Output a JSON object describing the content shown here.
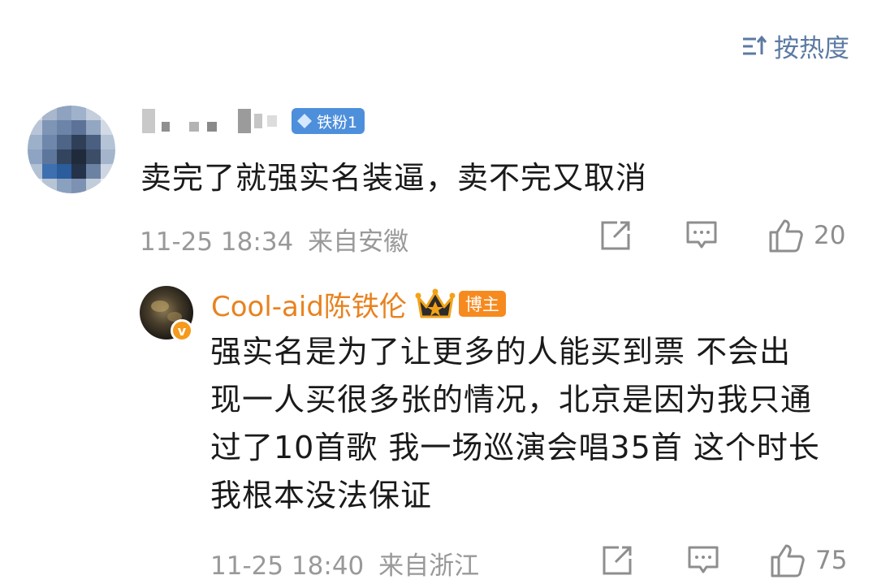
{
  "sort": {
    "label": "按热度",
    "icon": "sort-icon"
  },
  "comment": {
    "author_badge": "铁粉1",
    "text": "卖完了就强实名装逼，卖不完又取消",
    "time": "11-25 18:34",
    "location": "来自安徽",
    "likes": "20",
    "actions": [
      "share-icon",
      "comment-icon",
      "like-icon"
    ]
  },
  "reply": {
    "author": "Cool-aid陈铁伦",
    "role_badge": "博主",
    "verified": "v",
    "lines": [
      "强实名是为了让更多的人能买到票 不会出",
      "现一人买很多张的情况，北京是因为我只通",
      "过了10首歌 我一场巡演会唱35首 这个时长",
      "我根本没法保证"
    ],
    "time": "11-25 18:40",
    "location": "来自浙江",
    "likes": "75"
  },
  "colors": {
    "sort": "#5b7aa3",
    "meta": "#999999",
    "blogger_name": "#e8821f",
    "blogger_badge": "#f68a1f",
    "fan_badge": "#4e8fdc"
  }
}
